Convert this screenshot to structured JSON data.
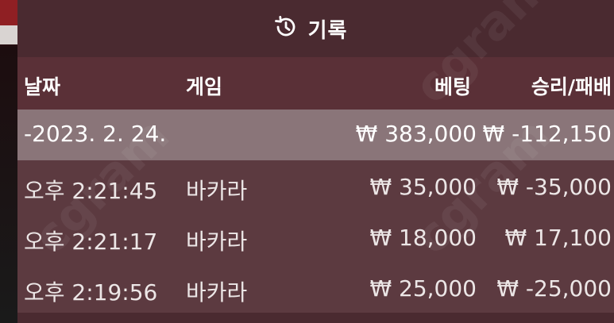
{
  "header": {
    "title": "기록",
    "icon": "history-icon"
  },
  "columns": {
    "date": "날짜",
    "game": "게임",
    "bet": "베팅",
    "result": "승리/패배"
  },
  "summary": {
    "date": "-2023. 2. 24.",
    "bet": "₩ 383,000",
    "result": "₩ -112,150"
  },
  "rows": [
    {
      "time": "오후 2:21:45",
      "game": "바카라",
      "bet": "₩ 35,000",
      "result": "₩ -35,000"
    },
    {
      "time": "오후 2:21:17",
      "game": "바카라",
      "bet": "₩ 18,000",
      "result": "₩ 17,100"
    },
    {
      "time": "오후 2:19:56",
      "game": "바카라",
      "bet": "₩ 25,000",
      "result": "₩ -25,000"
    }
  ],
  "watermark": "cgram"
}
